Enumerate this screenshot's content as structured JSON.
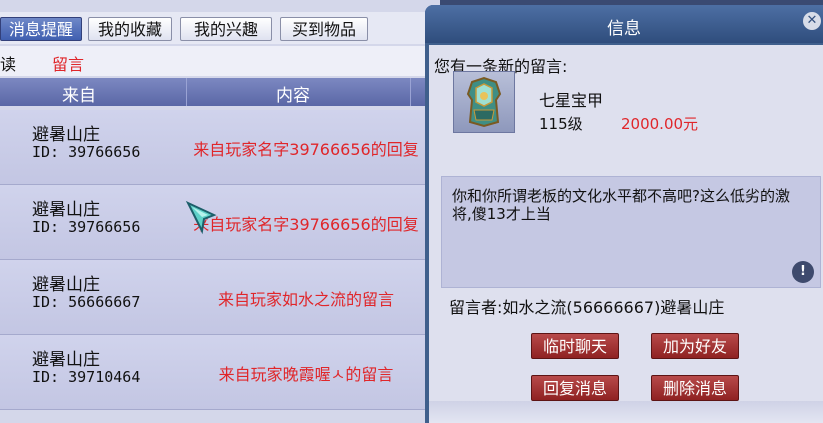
{
  "tabs": [
    {
      "label": "消息提醒"
    },
    {
      "label": "我的收藏"
    },
    {
      "label": "我的兴趣"
    },
    {
      "label": "买到物品"
    }
  ],
  "filter": {
    "left_text": "读",
    "active_text": "留言"
  },
  "columns": {
    "from": "来自",
    "content": "内容"
  },
  "rows": [
    {
      "name": "避暑山庄",
      "id": "ID: 39766656",
      "content": "来自玩家名字39766656的回复"
    },
    {
      "name": "避暑山庄",
      "id": "ID: 39766656",
      "content": "来自玩家名字39766656的回复"
    },
    {
      "name": "避暑山庄",
      "id": "ID: 56666667",
      "content": "来自玩家如水之流的留言"
    },
    {
      "name": "避暑山庄",
      "id": "ID: 39710464",
      "content": "来自玩家晚霞喔ㅅ的留言"
    }
  ],
  "dialog": {
    "title": "信息",
    "notice": "您有一条新的留言:",
    "item_name": "七星宝甲",
    "item_level": "115级",
    "item_price": "2000.00元",
    "message": "你和你所谓老板的文化水平都不高吧?这么低劣的激将,傻13才上当",
    "sender": "留言者:如水之流(56666667)避暑山庄",
    "buttons": {
      "chat": "临时聊天",
      "add_friend": "加为好友",
      "reply": "回复消息",
      "delete": "删除消息"
    }
  },
  "colors": {
    "accent_red": "#e0262a",
    "header_blue": "#5a67a6",
    "button_red": "#9a2a2a"
  }
}
